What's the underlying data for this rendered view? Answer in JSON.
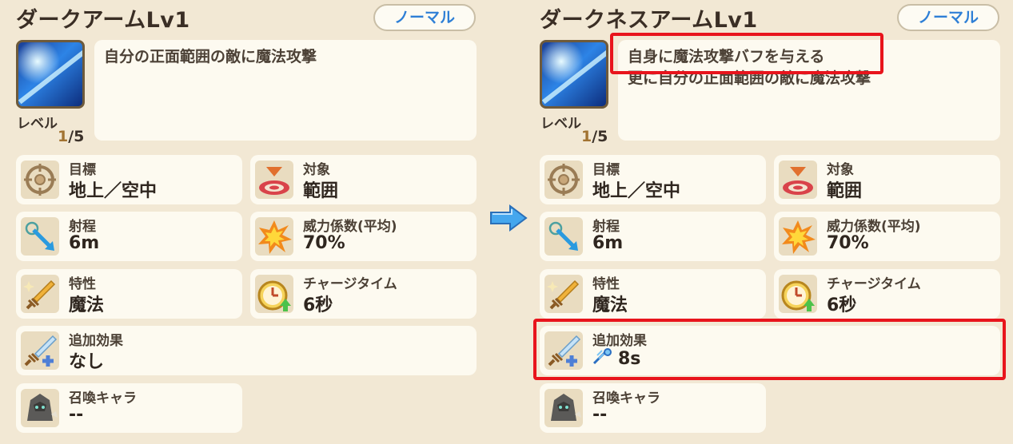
{
  "left": {
    "title": "ダークアームLv1",
    "rarity": "ノーマル",
    "description": [
      "自分の正面範囲の敵に魔法攻撃"
    ],
    "level_label": "レベル",
    "level_current": "1",
    "level_max": "/5",
    "stats": {
      "target": {
        "label": "目標",
        "value": "地上／空中"
      },
      "scope": {
        "label": "対象",
        "value": "範囲"
      },
      "range": {
        "label": "射程",
        "value": "6m"
      },
      "power": {
        "label": "威力係数(平均)",
        "value": "70%"
      },
      "attribute": {
        "label": "特性",
        "value": "魔法"
      },
      "charge": {
        "label": "チャージタイム",
        "value": "6秒"
      },
      "extra": {
        "label": "追加効果",
        "value": "なし"
      },
      "summon": {
        "label": "召喚キャラ",
        "value": "--"
      }
    }
  },
  "right": {
    "title": "ダークネスアームLv1",
    "rarity": "ノーマル",
    "description": [
      "自身に魔法攻撃バフを与える",
      "更に自分の正面範囲の敵に魔法攻撃"
    ],
    "level_label": "レベル",
    "level_current": "1",
    "level_max": "/5",
    "stats": {
      "target": {
        "label": "目標",
        "value": "地上／空中"
      },
      "scope": {
        "label": "対象",
        "value": "範囲"
      },
      "range": {
        "label": "射程",
        "value": "6m"
      },
      "power": {
        "label": "威力係数(平均)",
        "value": "70%"
      },
      "attribute": {
        "label": "特性",
        "value": "魔法"
      },
      "charge": {
        "label": "チャージタイム",
        "value": "6秒"
      },
      "extra": {
        "label": "追加効果",
        "value": "8s"
      },
      "summon": {
        "label": "召喚キャラ",
        "value": "--"
      }
    }
  },
  "colors": {
    "highlight": "#e8141c",
    "rarity_text": "#2e7fd6",
    "arrow": "#3aa0e8"
  },
  "icons": {
    "target": "crosshair-icon",
    "scope": "area-target-icon",
    "range": "range-arrow-icon",
    "power": "explosion-icon",
    "attribute": "sword-icon",
    "charge": "stopwatch-icon",
    "extra": "sword-plus-icon",
    "summon": "armored-monster-icon",
    "buff": "magic-buff-icon"
  }
}
